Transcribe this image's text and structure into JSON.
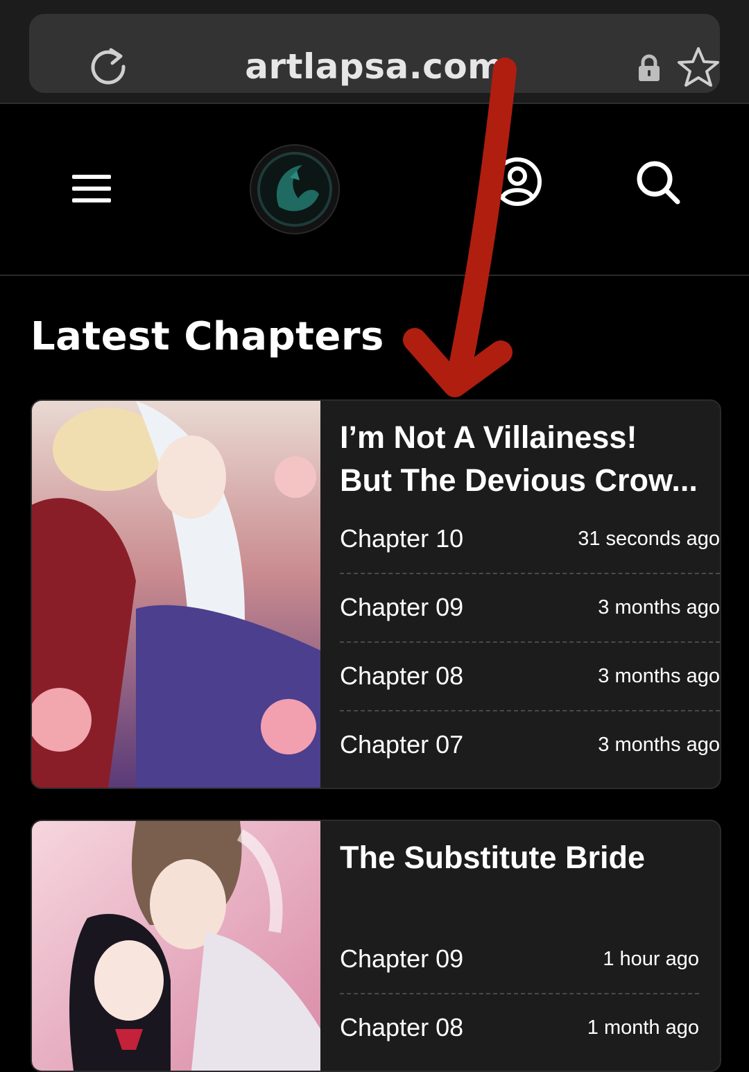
{
  "browser": {
    "url": "artlapsa.com"
  },
  "icons": {
    "reload": "reload-icon",
    "lock": "lock-icon",
    "bookmark": "star-icon",
    "menu": "hamburger-menu-icon",
    "account": "user-account-icon",
    "search": "search-icon",
    "annotation": "red-arrow-annotation"
  },
  "colors": {
    "background": "#000000",
    "card": "#1c1c1c",
    "annotation": "#b01e10"
  },
  "section": {
    "title": "Latest Chapters"
  },
  "series": [
    {
      "title_line1": "I’m Not A Villainess!",
      "title_line2": "But The Devious Crow...",
      "chapters": [
        {
          "name": "Chapter 10",
          "time": "31 seconds ago"
        },
        {
          "name": "Chapter 09",
          "time": "3 months ago"
        },
        {
          "name": "Chapter 08",
          "time": "3 months ago"
        },
        {
          "name": "Chapter 07",
          "time": "3 months ago"
        }
      ]
    },
    {
      "title_line1": "The Substitute Bride",
      "chapters": [
        {
          "name": "Chapter 09",
          "time": "1 hour ago"
        },
        {
          "name": "Chapter 08",
          "time": "1 month ago"
        }
      ]
    }
  ]
}
